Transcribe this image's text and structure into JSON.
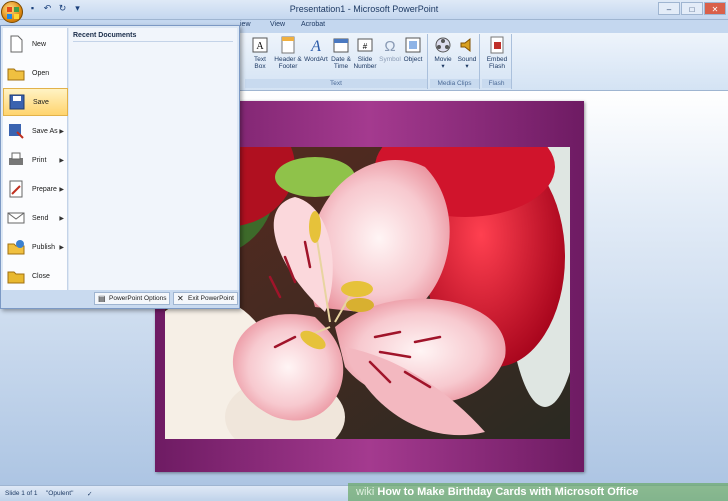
{
  "window": {
    "title": "Presentation1 - Microsoft PowerPoint"
  },
  "tabs": [
    "iew",
    "View",
    "Acrobat"
  ],
  "ribbon": {
    "text_group": {
      "label": "Text",
      "buttons": [
        "Text Box",
        "Header & Footer",
        "WordArt",
        "Date & Time",
        "Slide Number",
        "Symbol",
        "Object"
      ]
    },
    "media_group": {
      "label": "Media Clips",
      "buttons": [
        "Movie",
        "Sound"
      ]
    },
    "flash_group": {
      "label": "Flash",
      "buttons": [
        "Embed Flash"
      ]
    }
  },
  "office_menu": {
    "items": [
      {
        "label": "New",
        "icon": "new-document-icon",
        "arrow": false
      },
      {
        "label": "Open",
        "icon": "open-folder-icon",
        "arrow": false
      },
      {
        "label": "Save",
        "icon": "save-disk-icon",
        "arrow": false,
        "active": true
      },
      {
        "label": "Save As",
        "icon": "save-as-icon",
        "arrow": true
      },
      {
        "label": "Print",
        "icon": "printer-icon",
        "arrow": true
      },
      {
        "label": "Prepare",
        "icon": "prepare-icon",
        "arrow": true
      },
      {
        "label": "Send",
        "icon": "send-icon",
        "arrow": true
      },
      {
        "label": "Publish",
        "icon": "publish-icon",
        "arrow": true
      },
      {
        "label": "Close",
        "icon": "close-folder-icon",
        "arrow": false
      }
    ],
    "recent_title": "Recent Documents",
    "options_button": "PowerPoint Options",
    "exit_button": "Exit PowerPoint"
  },
  "status": {
    "slide": "Slide 1 of 1",
    "theme": "\"Opulent\""
  },
  "watermark": {
    "prefix": "wiki",
    "text": "How to Make Birthday Cards with Microsoft Office"
  },
  "colors": {
    "accent": "#ffd46e",
    "slide_bg": "#8b2a78",
    "ribbon": "#d4e3f4"
  }
}
